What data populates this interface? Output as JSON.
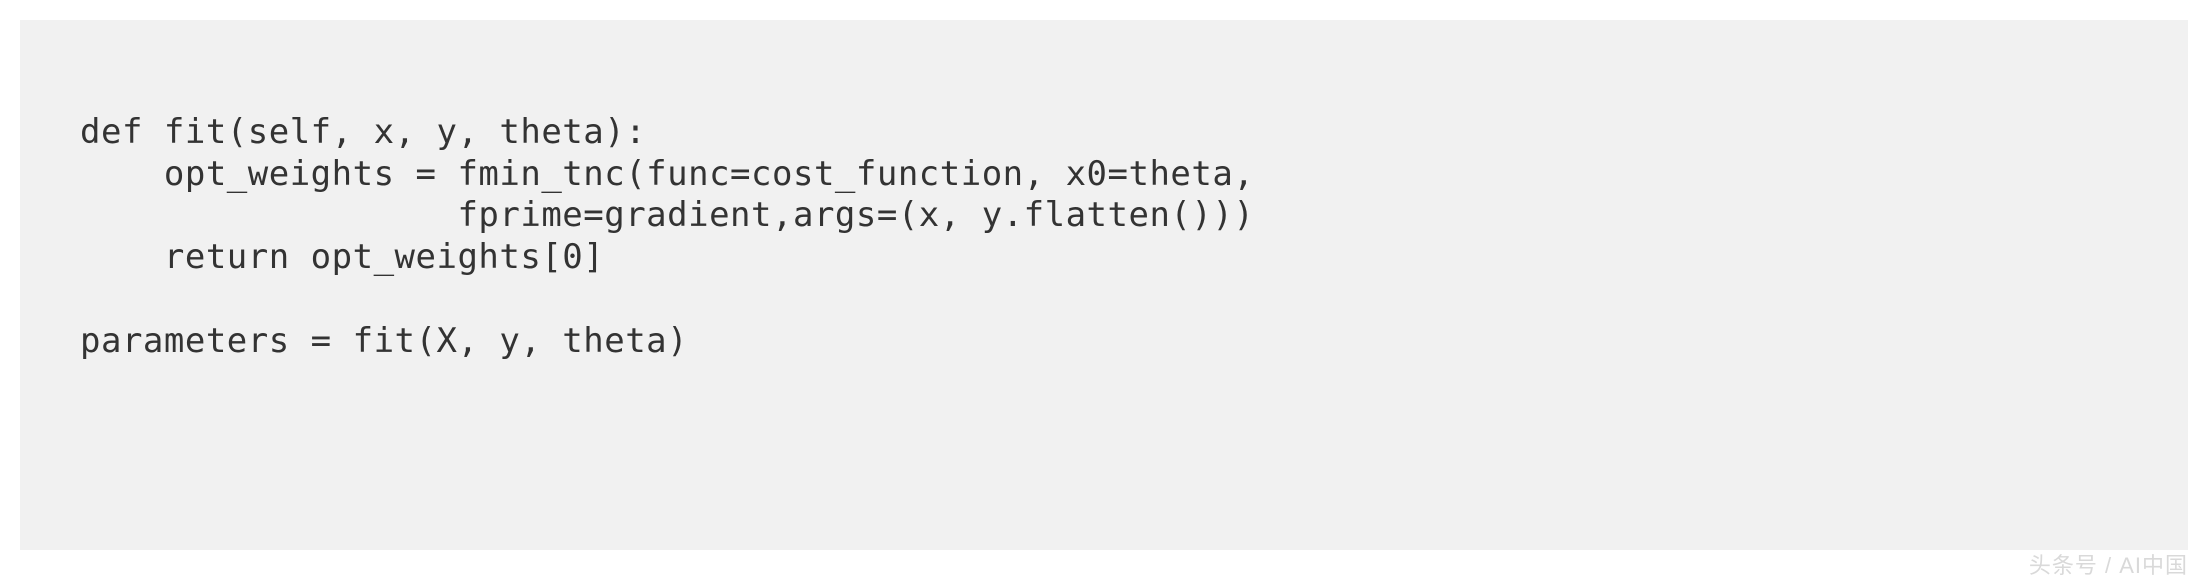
{
  "code": {
    "lines": [
      "def fit(self, x, y, theta):",
      "    opt_weights = fmin_tnc(func=cost_function, x0=theta,",
      "                  fprime=gradient,args=(x, y.flatten()))",
      "    return opt_weights[0]",
      "",
      "parameters = fit(X, y, theta)"
    ]
  },
  "watermark": {
    "text": "头条号 / AI中国"
  }
}
